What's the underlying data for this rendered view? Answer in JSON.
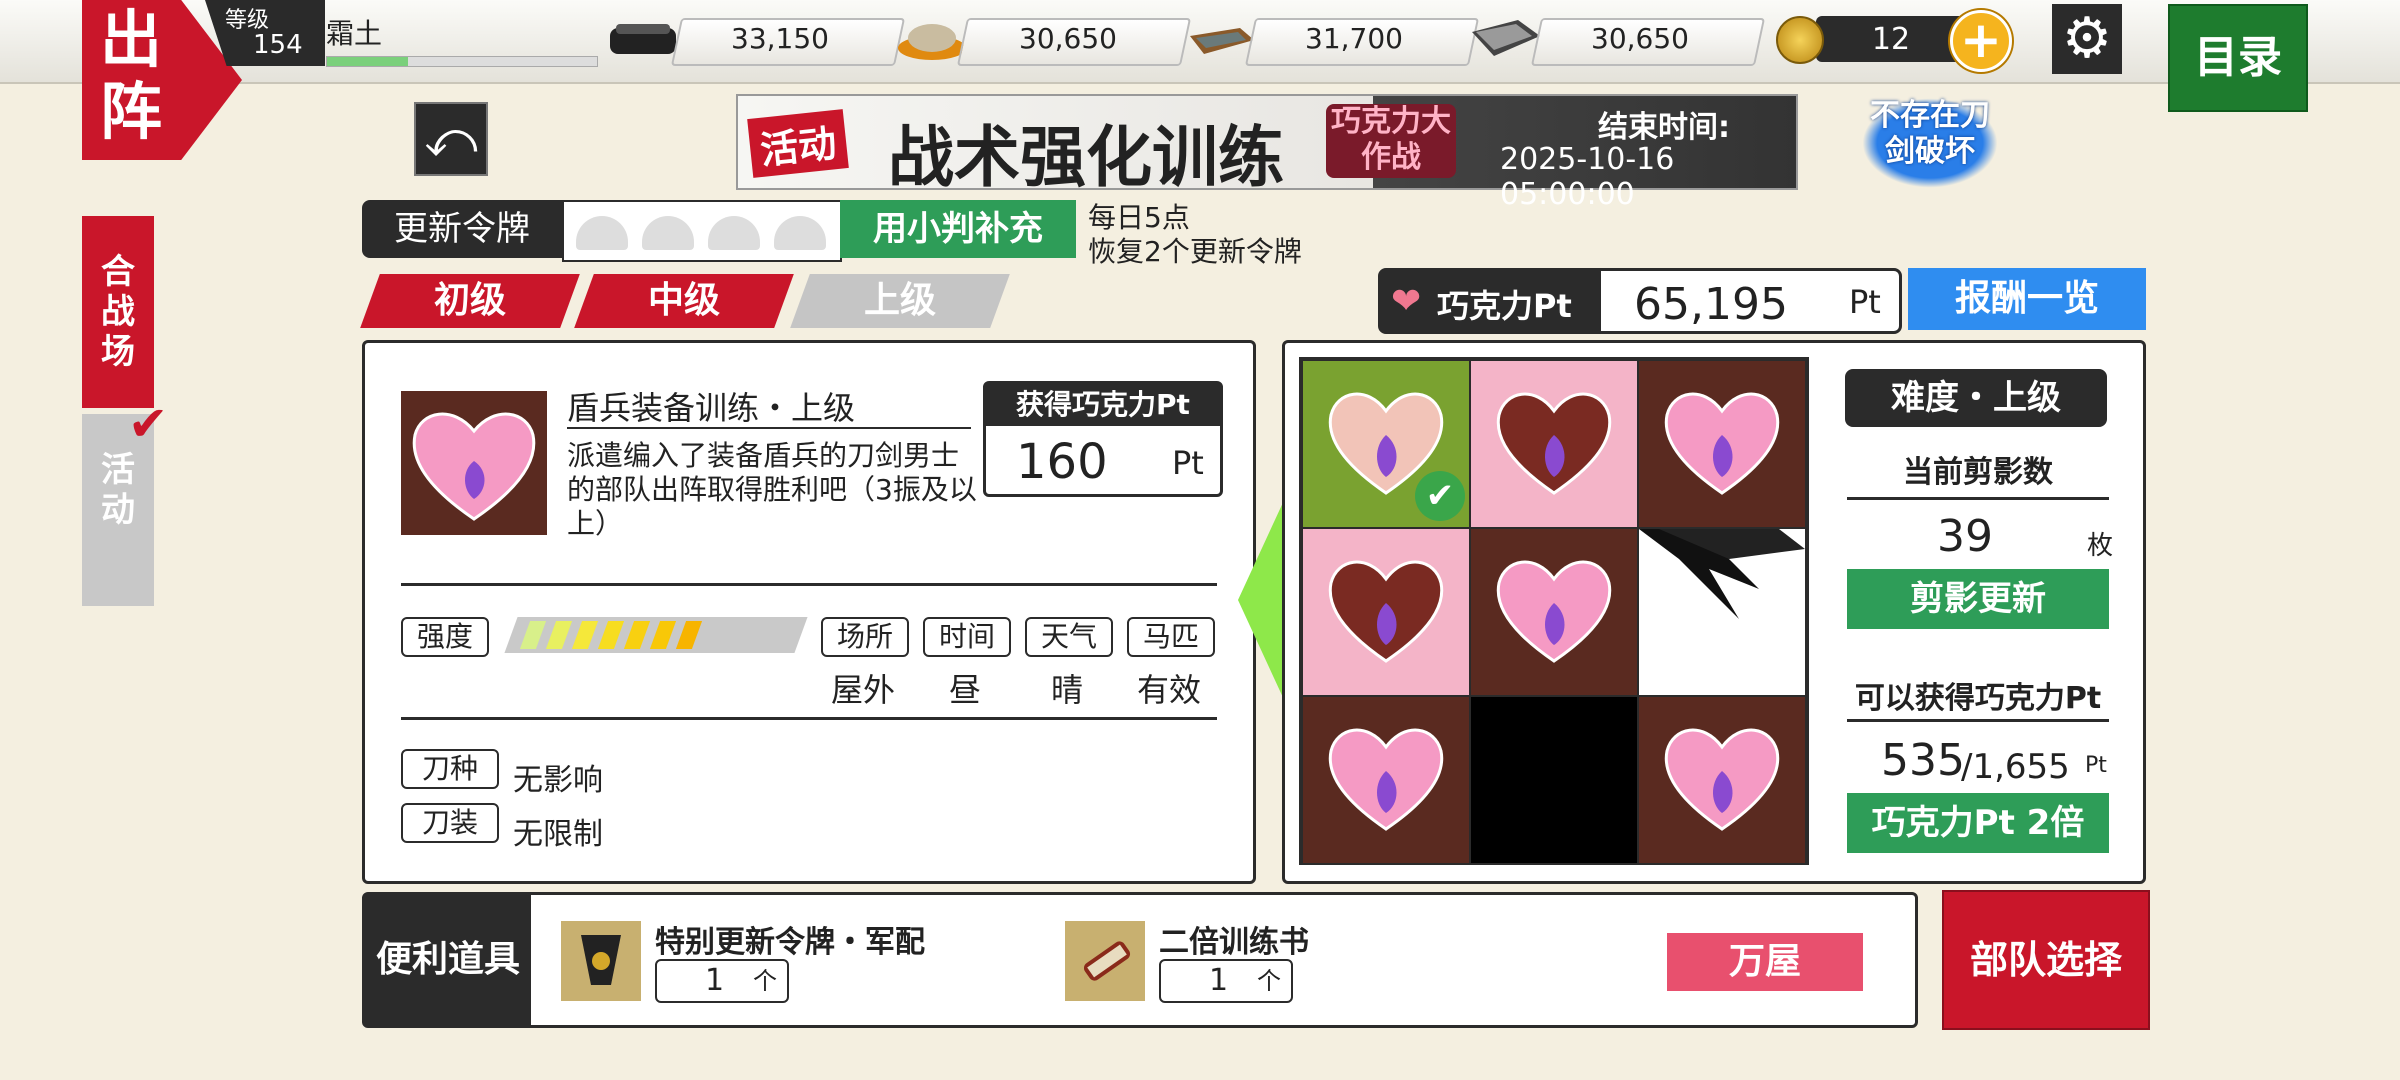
{
  "header": {
    "sortie_title_1": "出",
    "sortie_title_2": "阵",
    "level_label": "等级",
    "level_value": "154",
    "player_name": "霜土",
    "exp_progress": 0.3,
    "resources": [
      {
        "icon": "charcoal-icon",
        "value": "33,150"
      },
      {
        "icon": "cooling-material-icon",
        "value": "30,650"
      },
      {
        "icon": "whetstone-icon",
        "value": "31,700"
      },
      {
        "icon": "steel-icon",
        "value": "30,650"
      }
    ],
    "koban_value": "12",
    "plus_label": "+",
    "menu_label": "目录"
  },
  "sidebar": {
    "tab_battlefield": "合战场",
    "tab_event": "活动"
  },
  "banner": {
    "tag": "活动",
    "title": "战术强化训练",
    "subtitle": "巧克力大作战",
    "end_label": "结束时间:",
    "end_time": "2025-10-16 05:00:00",
    "no_break_notice": "不存在刀剑破坏"
  },
  "tokens": {
    "label": "更新令牌",
    "refill_button": "用小判补充",
    "info_line1": "每日5点",
    "info_line2": "恢复2个更新令牌"
  },
  "difficulty_tabs": [
    "初级",
    "中级",
    "上级"
  ],
  "choco_pt": {
    "label": "巧克力Pt",
    "value": "65,195",
    "unit": "Pt",
    "reward_button": "报酬一览"
  },
  "mission": {
    "title": "盾兵装备训练・上级",
    "description": "派遣编入了装备盾兵的刀剑男士的部队出阵取得胜利吧（3振及以上）",
    "reward_label": "获得巧克力Pt",
    "reward_value": "160",
    "reward_unit": "Pt",
    "strength_label": "强度",
    "strength_level": 7,
    "strength_max": 10,
    "conditions": [
      {
        "label": "场所",
        "value": "屋外"
      },
      {
        "label": "时间",
        "value": "昼"
      },
      {
        "label": "天气",
        "value": "晴"
      },
      {
        "label": "马匹",
        "value": "有效"
      }
    ],
    "sword_type_label": "刀种",
    "sword_type_value": "无影响",
    "equip_label": "刀装",
    "equip_value": "无限制"
  },
  "board": {
    "difficulty_label": "难度・上级",
    "silhouette_label": "当前剪影数",
    "silhouette_value": "39",
    "silhouette_unit": "枚",
    "refresh_button": "剪影更新",
    "gain_label": "可以获得巧克力Pt",
    "gain_value": "535",
    "gain_max": "/1,655",
    "gain_unit": "Pt",
    "double_button": "巧克力Pt 2倍"
  },
  "items": {
    "label": "便利道具",
    "item1_name": "特别更新令牌・军配",
    "item1_qty": "1",
    "item1_unit": "个",
    "item2_name": "二倍训练书",
    "item2_qty": "1",
    "item2_unit": "个",
    "shop_button": "万屋"
  },
  "squad_button": "部队选择",
  "colors": {
    "accent_red": "#c9162a",
    "green": "#2e9d58",
    "blue": "#2f8df0",
    "pink": "#f4a4c4",
    "dark": "#2b2b2b"
  }
}
